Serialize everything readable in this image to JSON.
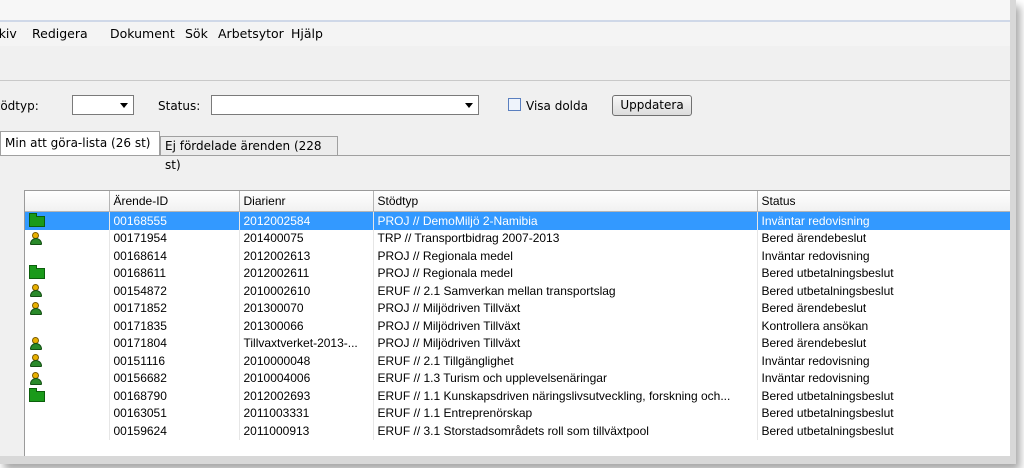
{
  "menu": [
    "Arkiv",
    "Redigera",
    "Dokument",
    "Sök",
    "Arbetsytor",
    "Hjälp"
  ],
  "filters": {
    "stodtyp_label": "Stödtyp:",
    "stodtyp_value": "",
    "status_label": "Status:",
    "status_value": "",
    "visa_dolda_label": "Visa dolda",
    "visa_dolda_checked": false,
    "update_button": "Uppdatera"
  },
  "tabs": [
    {
      "label": "Min att göra-lista (26 st)",
      "active": true
    },
    {
      "label": "Ej fördelade ärenden (228 st)",
      "active": false
    }
  ],
  "table": {
    "columns": [
      "",
      "Ärende-ID",
      "Diarienr",
      "Stödtyp",
      "Status"
    ],
    "rows": [
      {
        "icon": "folder-icon",
        "id": "00168555",
        "diarienr": "2012002584",
        "stodtyp": "PROJ // DemoMiljö 2-Namibia",
        "status": "Inväntar redovisning",
        "selected": true
      },
      {
        "icon": "person-icon",
        "id": "00171954",
        "diarienr": "201400075",
        "stodtyp": "TRP // Transportbidrag 2007-2013",
        "status": "Bered ärendebeslut"
      },
      {
        "icon": "",
        "id": "00168614",
        "diarienr": "2012002613",
        "stodtyp": "PROJ // Regionala medel",
        "status": "Inväntar redovisning"
      },
      {
        "icon": "folder-icon",
        "id": "00168611",
        "diarienr": "2012002611",
        "stodtyp": "PROJ // Regionala medel",
        "status": "Bered utbetalningsbeslut"
      },
      {
        "icon": "person-icon",
        "id": "00154872",
        "diarienr": "2010002610",
        "stodtyp": "ERUF // 2.1 Samverkan mellan transportslag",
        "status": "Bered utbetalningsbeslut"
      },
      {
        "icon": "person-icon",
        "id": "00171852",
        "diarienr": "201300070",
        "stodtyp": "PROJ // Miljödriven Tillväxt",
        "status": "Bered ärendebeslut"
      },
      {
        "icon": "",
        "id": "00171835",
        "diarienr": "201300066",
        "stodtyp": "PROJ // Miljödriven Tillväxt",
        "status": "Kontrollera ansökan"
      },
      {
        "icon": "person-icon",
        "id": "00171804",
        "diarienr": "Tillvaxtverket-2013-...",
        "stodtyp": "PROJ // Miljödriven Tillväxt",
        "status": "Bered ärendebeslut"
      },
      {
        "icon": "person-icon",
        "id": "00151116",
        "diarienr": "2010000048",
        "stodtyp": "ERUF // 2.1 Tillgänglighet",
        "status": "Inväntar redovisning"
      },
      {
        "icon": "person-icon",
        "id": "00156682",
        "diarienr": "2010004006",
        "stodtyp": "ERUF // 1.3 Turism och upplevelsenäringar",
        "status": "Inväntar redovisning"
      },
      {
        "icon": "folder-icon",
        "id": "00168790",
        "diarienr": "2012002693",
        "stodtyp": "ERUF // 1.1 Kunskapsdriven näringslivsutveckling, forskning och...",
        "status": "Bered utbetalningsbeslut"
      },
      {
        "icon": "",
        "id": "00163051",
        "diarienr": "2011003331",
        "stodtyp": "ERUF // 1.1 Entreprenörskap",
        "status": "Bered utbetalningsbeslut"
      },
      {
        "icon": "",
        "id": "00159624",
        "diarienr": "2011000913",
        "stodtyp": "ERUF // 3.1 Storstadsområdets roll som tillväxtpool",
        "status": "Bered utbetalningsbeslut"
      }
    ]
  },
  "colors": {
    "selection": "#3399ff",
    "folder": "#1a9a1a",
    "person_head": "#e8b000"
  }
}
